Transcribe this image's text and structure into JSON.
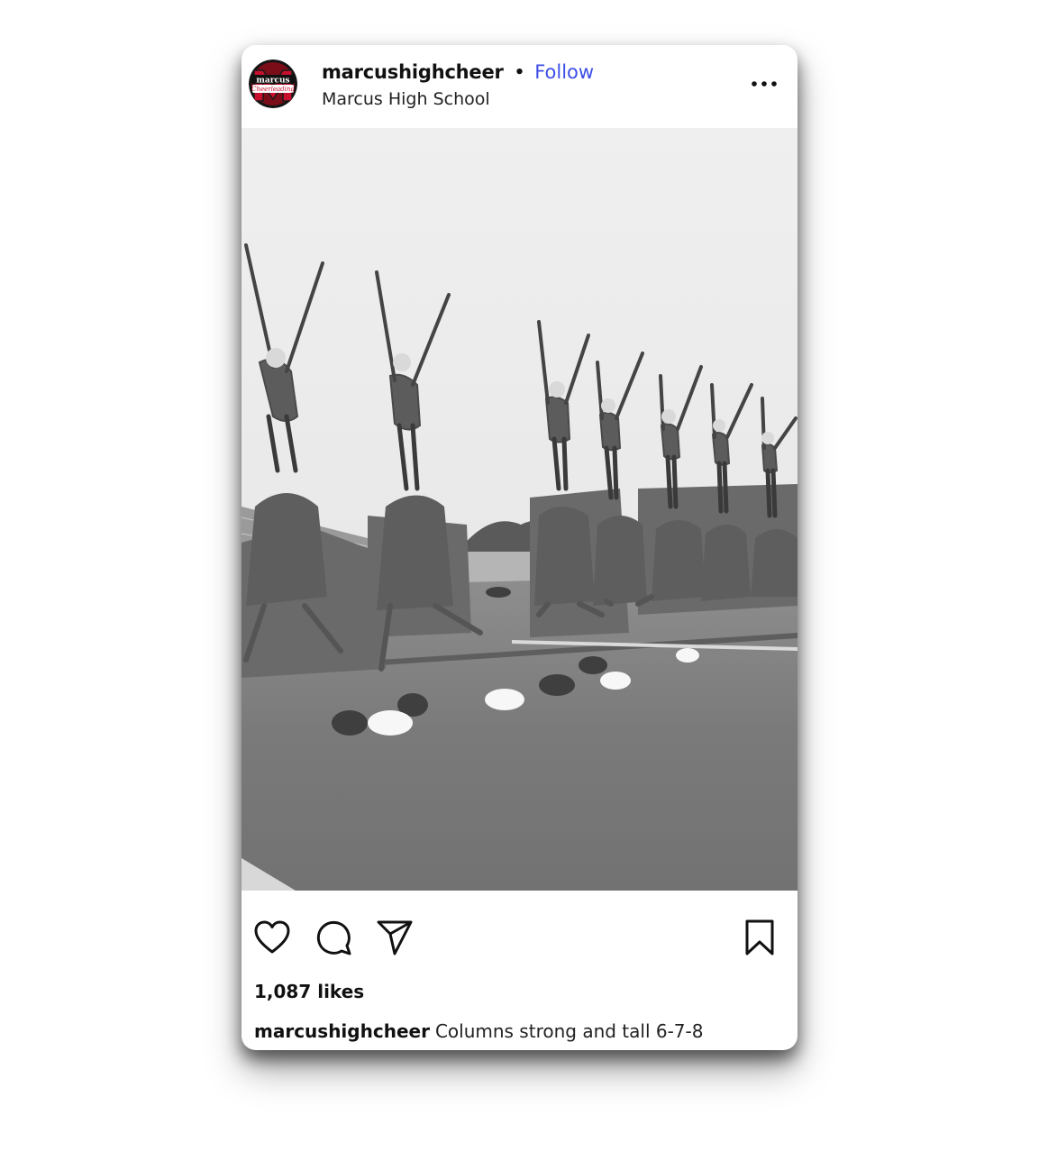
{
  "post": {
    "username": "marcushighcheer",
    "separator": "•",
    "follow_label": "Follow",
    "location": "Marcus High School",
    "more_icon": "more-horizontal-icon",
    "avatar": {
      "logo_text_top": "marcus",
      "logo_text_bottom": "Cheerleading",
      "brand_colors": [
        "#c8102e",
        "#111111",
        "#ffffff"
      ]
    },
    "photo": {
      "style": "black-and-white",
      "icon": "photo-cheerleader-stunts"
    },
    "actions": {
      "like_icon": "heart-icon",
      "comment_icon": "comment-icon",
      "share_icon": "send-icon",
      "save_icon": "bookmark-icon"
    },
    "likes_text": "1,087 likes",
    "caption": {
      "username": "marcushighcheer",
      "text": "Columns strong and tall 6-7-8"
    }
  },
  "colors": {
    "follow": "#3d4ee6",
    "text": "#111111",
    "card_bg": "#ffffff"
  }
}
